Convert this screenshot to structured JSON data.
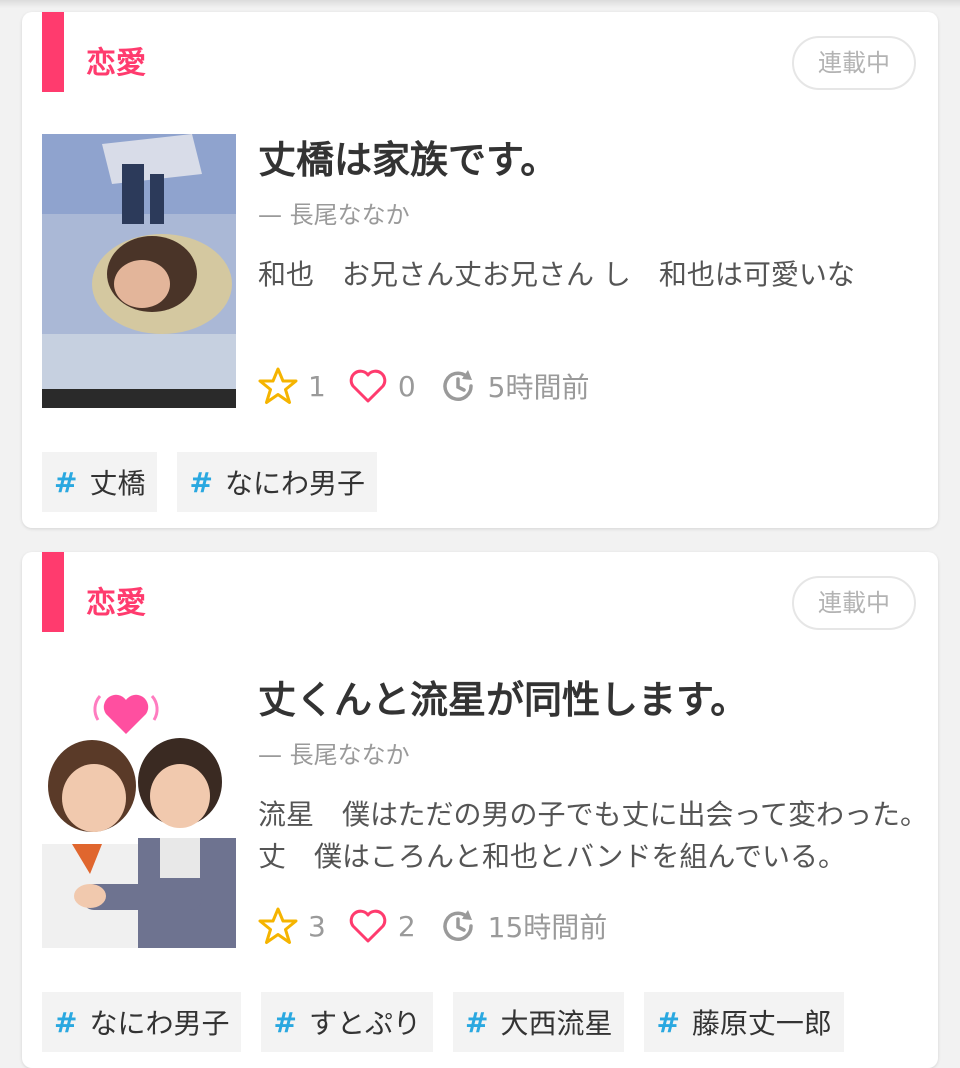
{
  "colors": {
    "accent": "#ff3b6e",
    "star": "#f5b400",
    "heart": "#ff3b6e",
    "hash": "#2aa8e0",
    "muted": "#9a9a9a"
  },
  "icons": [
    "star-icon",
    "heart-icon",
    "clock-refresh-icon",
    "hash-icon"
  ],
  "stories": [
    {
      "genre": "恋愛",
      "status": "連載中",
      "title": "丈橋は家族です。",
      "author": "— 長尾ななか",
      "summary": "和也　お兄さん丈お兄さん し　和也は可愛いな",
      "stars": "1",
      "likes": "0",
      "updated": "5時間前",
      "tags": [
        "丈橋",
        "なにわ男子"
      ]
    },
    {
      "genre": "恋愛",
      "status": "連載中",
      "title": "丈くんと流星が同性します。",
      "author": "— 長尾ななか",
      "summary": "流星　僕はただの男の子でも丈に出会って変わった。　 丈　僕はころんと和也とバンドを組んでいる。",
      "stars": "3",
      "likes": "2",
      "updated": "15時間前",
      "tags": [
        "なにわ男子",
        "すとぷり",
        "大西流星",
        "藤原丈一郎"
      ]
    }
  ]
}
